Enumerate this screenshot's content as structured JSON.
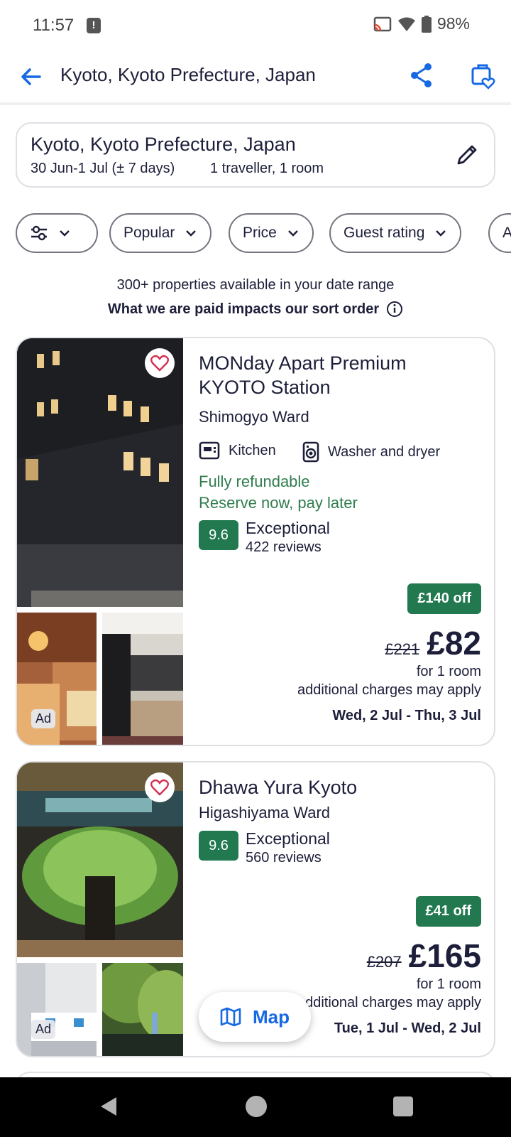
{
  "status_bar": {
    "time": "11:57",
    "battery": "98%"
  },
  "header": {
    "title": "Kyoto, Kyoto Prefecture, Japan"
  },
  "search": {
    "destination": "Kyoto, Kyoto Prefecture, Japan",
    "dates": "30 Jun-1 Jul (± 7 days)",
    "guests": "1 traveller, 1 room"
  },
  "filters": [
    {
      "label": ""
    },
    {
      "label": "Popular"
    },
    {
      "label": "Price"
    },
    {
      "label": "Guest rating"
    },
    {
      "label": "A"
    }
  ],
  "results": {
    "availability": "300+ properties available in your date range",
    "sort_note": "What we are paid impacts our sort order"
  },
  "properties": [
    {
      "name": "MONday Apart Premium KYOTO Station",
      "area": "Shimogyo Ward",
      "amenities": [
        "Kitchen",
        "Washer and dryer"
      ],
      "refundable": "Fully refundable",
      "pay_later": "Reserve now, pay later",
      "score": "9.6",
      "rating_word": "Exceptional",
      "reviews": "422 reviews",
      "discount": "£140 off",
      "old_price": "£221",
      "price": "£82",
      "price_unit": "for 1 room",
      "charges_note": "additional charges may apply",
      "stay_dates": "Wed, 2 Jul - Thu, 3 Jul",
      "ad_label": "Ad"
    },
    {
      "name": "Dhawa Yura Kyoto",
      "area": "Higashiyama Ward",
      "score": "9.6",
      "rating_word": "Exceptional",
      "reviews": "560 reviews",
      "discount": "£41 off",
      "old_price": "£207",
      "price": "£165",
      "price_unit": "for 1 room",
      "charges_note": "additional charges may apply",
      "stay_dates": "Tue, 1 Jul - Wed, 2 Jul",
      "ad_label": "Ad"
    }
  ],
  "map_button": {
    "label": "Map"
  },
  "colors": {
    "brand_blue": "#1668e3",
    "rating_green": "#227950",
    "refund_green": "#2f7d4e",
    "favorite_red": "#d32f4f"
  }
}
